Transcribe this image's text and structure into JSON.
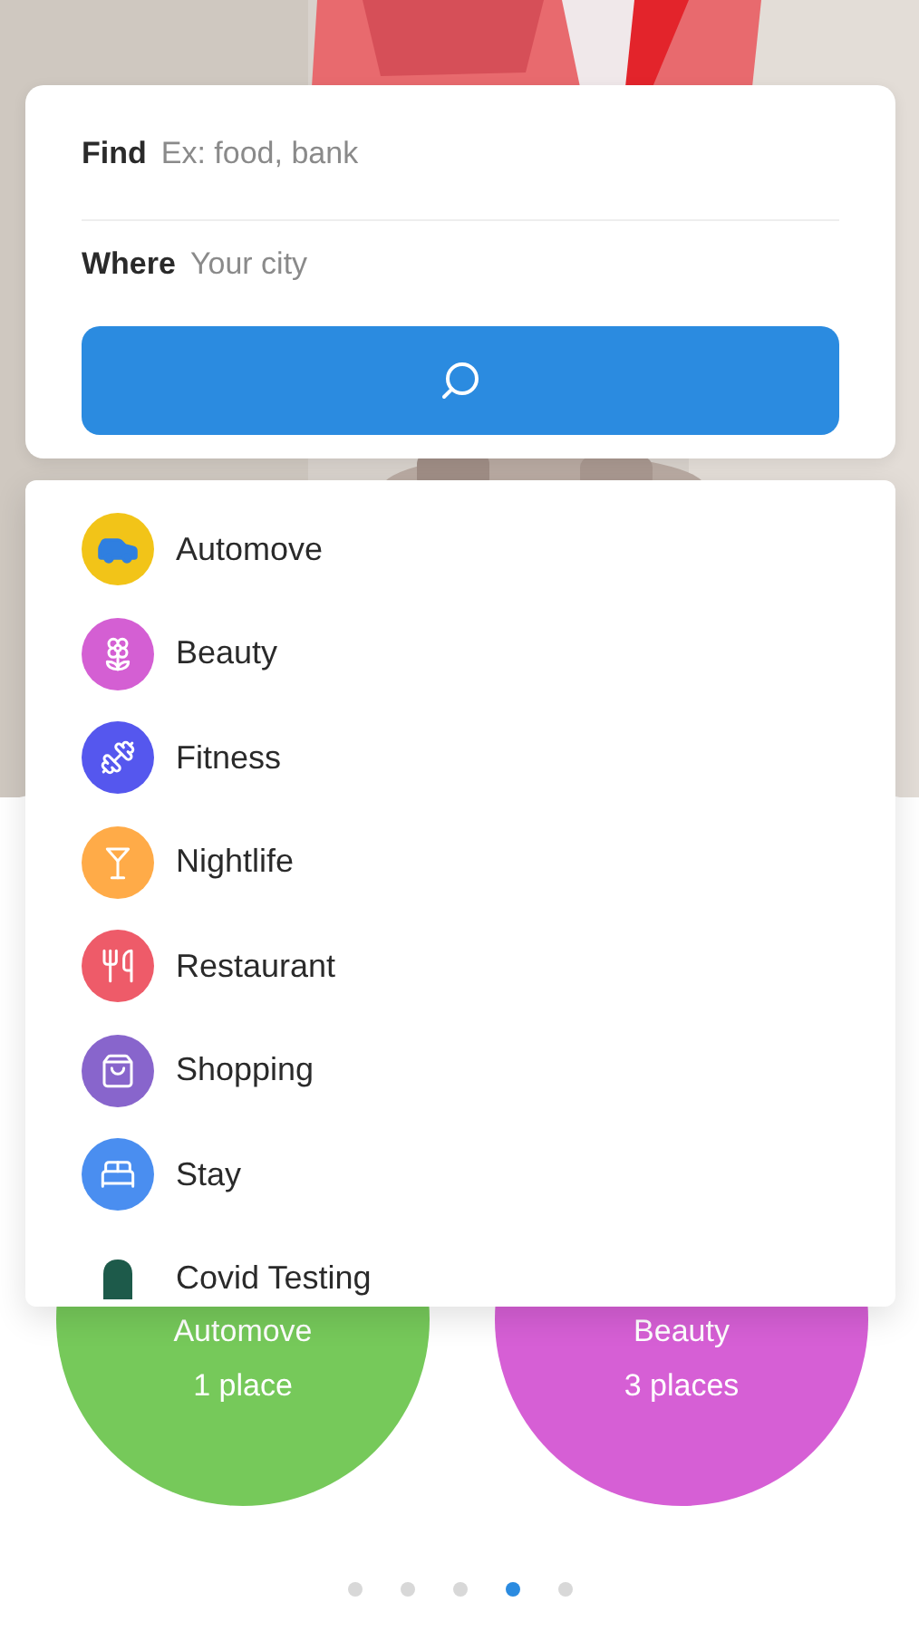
{
  "search": {
    "find_label": "Find",
    "find_placeholder": "Ex: food, bank",
    "where_label": "Where",
    "where_placeholder": "Your city"
  },
  "categories": [
    {
      "name": "Automove",
      "kind": "car",
      "color": "#f2c418"
    },
    {
      "name": "Beauty",
      "kind": "flower",
      "color": "#d45fd3"
    },
    {
      "name": "Fitness",
      "kind": "dumbbell",
      "color": "#5557ee"
    },
    {
      "name": "Nightlife",
      "kind": "cocktail",
      "color": "#ffab48"
    },
    {
      "name": "Restaurant",
      "kind": "utensils",
      "color": "#ee5b69"
    },
    {
      "name": "Shopping",
      "kind": "bag",
      "color": "#8865cc"
    },
    {
      "name": "Stay",
      "kind": "bed",
      "color": "#4a8ef0"
    },
    {
      "name": "Covid Testing",
      "kind": "covid",
      "color": "#1d5a4a"
    }
  ],
  "featured": [
    {
      "name": "Automove",
      "count": "1 place",
      "color": "#76c95a"
    },
    {
      "name": "Beauty",
      "count": "3 places",
      "color": "#d65fd5"
    }
  ],
  "pager": [
    {
      "selected": false
    },
    {
      "selected": false
    },
    {
      "selected": false
    },
    {
      "selected": true
    },
    {
      "selected": false
    }
  ]
}
